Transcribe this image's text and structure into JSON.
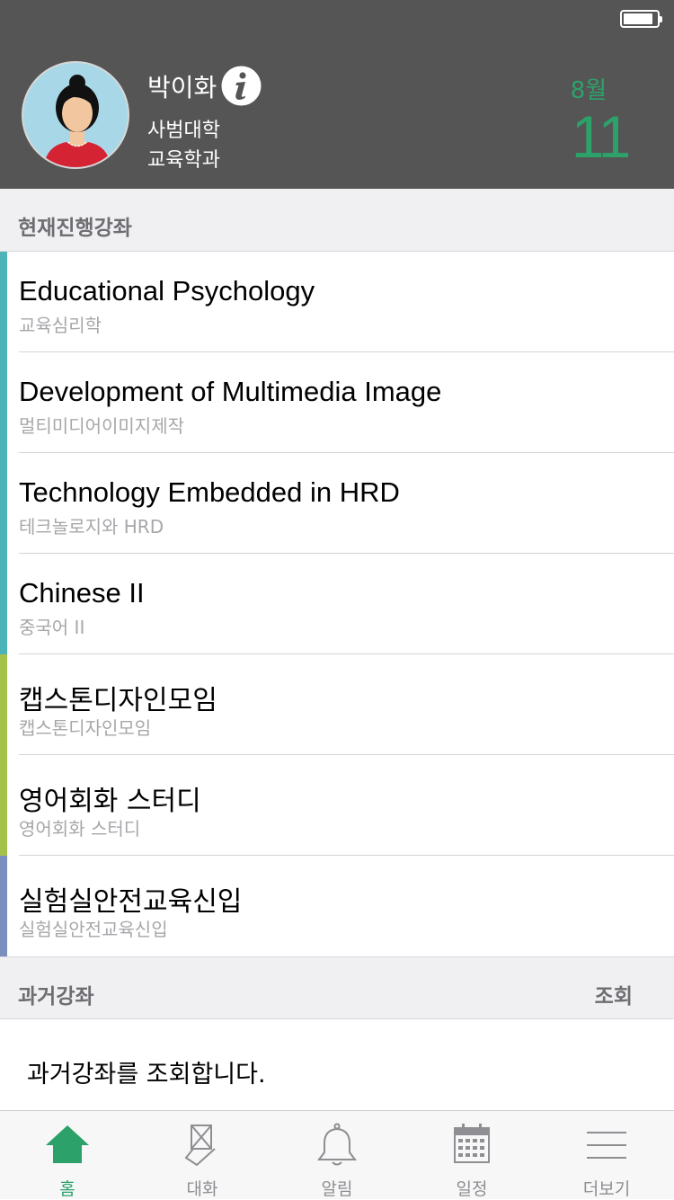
{
  "status_bar": {
    "battery_icon": "battery-icon"
  },
  "profile": {
    "name": "박이화",
    "college": "사범대학",
    "department": "교육학과",
    "info_icon": "info-icon"
  },
  "date": {
    "month": "8월",
    "day": "11",
    "color": "#2ca26a"
  },
  "current_section": {
    "title": "현재진행강좌"
  },
  "courses": [
    {
      "name": "Educational Psychology",
      "subtitle": "교육심리학",
      "bar_color": "#4cb3b9"
    },
    {
      "name": "Development of Multimedia Image",
      "subtitle": "멀티미디어이미지제작",
      "bar_color": "#4cb3b9"
    },
    {
      "name": "Technology Embedded in HRD",
      "subtitle": "테크놀로지와 HRD",
      "bar_color": "#4cb3b9"
    },
    {
      "name": "Chinese II",
      "subtitle": "중국어 II",
      "bar_color": "#4cb3b9"
    },
    {
      "name": "캡스톤디자인모임",
      "subtitle": "캡스톤디자인모임",
      "bar_color": "#a4c249"
    },
    {
      "name": "영어회화 스터디",
      "subtitle": "영어회화 스터디",
      "bar_color": "#a4c249"
    },
    {
      "name": "실험실안전교육신입",
      "subtitle": "실험실안전교육신입",
      "bar_color": "#7a8fbf"
    }
  ],
  "past_section": {
    "title": "과거강좌",
    "action": "조회"
  },
  "past_body": {
    "text": "과거강좌를 조회합니다."
  },
  "tabs": [
    {
      "label": "홈",
      "icon": "home-icon",
      "active": true
    },
    {
      "label": "대화",
      "icon": "chat-icon",
      "active": false
    },
    {
      "label": "알림",
      "icon": "bell-icon",
      "active": false
    },
    {
      "label": "일정",
      "icon": "calendar-icon",
      "active": false
    },
    {
      "label": "더보기",
      "icon": "menu-icon",
      "active": false
    }
  ],
  "colors": {
    "accent": "#2ca26a",
    "header_bg": "#555556",
    "section_bg": "#f0f0f3"
  }
}
